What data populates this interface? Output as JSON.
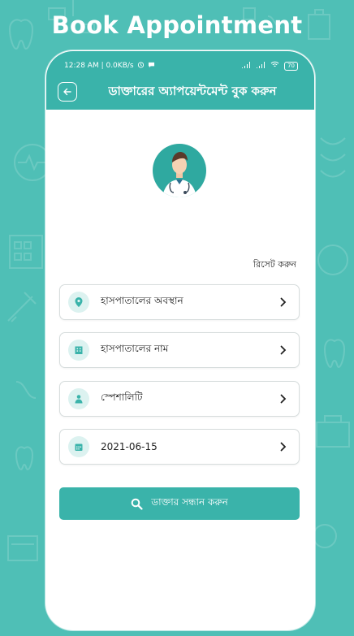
{
  "promo": {
    "title": "Book Appointment"
  },
  "status": {
    "time": "12:28 AM | 0.0KB/s",
    "battery": "70"
  },
  "appbar": {
    "title": "ডাক্তারের অ্যাপয়েন্টমেন্ট বুক করুন"
  },
  "reset_label": "রিসেট করুন",
  "fields": [
    {
      "label": "হাসপাতালের অবস্থান",
      "icon": "location-pin-icon"
    },
    {
      "label": "হাসপাতালের নাম",
      "icon": "hospital-building-icon"
    },
    {
      "label": "স্পেশালিটি",
      "icon": "person-icon"
    },
    {
      "label": "2021-06-15",
      "icon": "calendar-icon"
    }
  ],
  "search_button": {
    "label": "ডাক্তার সন্ধান করুন"
  },
  "colors": {
    "accent": "#3ab3aa",
    "background": "#4fbfb6",
    "icon_bg": "#dcf2f0"
  }
}
